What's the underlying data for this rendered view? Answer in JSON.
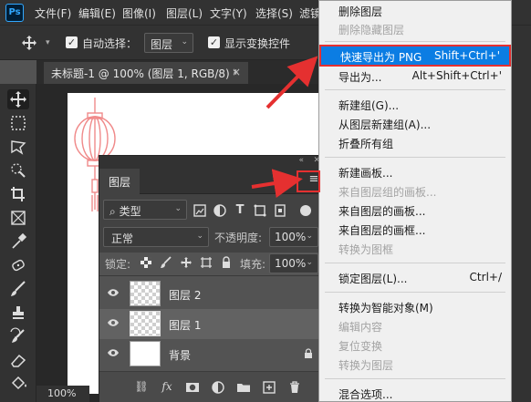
{
  "app": {
    "logo": "Ps"
  },
  "menubar": {
    "items": [
      "文件(F)",
      "编辑(E)",
      "图像(I)",
      "图层(L)",
      "文字(Y)",
      "选择(S)",
      "滤镜"
    ]
  },
  "options": {
    "auto_select_label": "自动选择：",
    "auto_select_value": "图层",
    "show_transform_label": "显示变换控件"
  },
  "document": {
    "tab_title": "未标题-1 @ 100% (图层 1, RGB/8) *",
    "close": "×"
  },
  "statusbar": {
    "zoom": "100%"
  },
  "layers_panel": {
    "title": "图层",
    "filter_label": "类型",
    "blend_mode": "正常",
    "opacity_label": "不透明度:",
    "opacity": "100%",
    "lock_label": "锁定:",
    "fill_label": "填充:",
    "fill": "100%",
    "layers": [
      {
        "name": "图层 2",
        "selected": false,
        "locked": false
      },
      {
        "name": "图层 1",
        "selected": true,
        "locked": false
      },
      {
        "name": "背景",
        "selected": false,
        "locked": true
      }
    ],
    "footer_icons": [
      "link-icon",
      "fx-icon",
      "mask-icon",
      "adjustment-icon",
      "group-folder-icon",
      "new-layer-icon",
      "trash-icon"
    ],
    "fx_label": "fx"
  },
  "context_menu": {
    "items": [
      {
        "label": "删除图层",
        "shortcut": "",
        "enabled": true
      },
      {
        "label": "删除隐藏图层",
        "shortcut": "",
        "enabled": false
      },
      {
        "label": "快速导出为 PNG",
        "shortcut": "Shift+Ctrl+'",
        "enabled": true,
        "highlighted": true
      },
      {
        "label": "导出为...",
        "shortcut": "Alt+Shift+Ctrl+'",
        "enabled": true
      },
      {
        "label": "新建组(G)...",
        "shortcut": "",
        "enabled": true
      },
      {
        "label": "从图层新建组(A)...",
        "shortcut": "",
        "enabled": true
      },
      {
        "label": "折叠所有组",
        "shortcut": "",
        "enabled": true
      },
      {
        "label": "新建画板...",
        "shortcut": "",
        "enabled": true
      },
      {
        "label": "来自图层组的画板...",
        "shortcut": "",
        "enabled": false
      },
      {
        "label": "来自图层的画板...",
        "shortcut": "",
        "enabled": true
      },
      {
        "label": "来自图层的画框...",
        "shortcut": "",
        "enabled": true
      },
      {
        "label": "转换为图框",
        "shortcut": "",
        "enabled": false
      },
      {
        "label": "锁定图层(L)...",
        "shortcut": "Ctrl+/",
        "enabled": true
      },
      {
        "label": "转换为智能对象(M)",
        "shortcut": "",
        "enabled": true
      },
      {
        "label": "编辑内容",
        "shortcut": "",
        "enabled": false
      },
      {
        "label": "复位变换",
        "shortcut": "",
        "enabled": false
      },
      {
        "label": "转换为图层",
        "shortcut": "",
        "enabled": false
      },
      {
        "label": "混合选项...",
        "shortcut": "",
        "enabled": true
      }
    ]
  },
  "colors": {
    "accent_highlight": "#0b7de3",
    "annotation_red": "#e53030",
    "lantern_pink": "#f08a8a"
  }
}
